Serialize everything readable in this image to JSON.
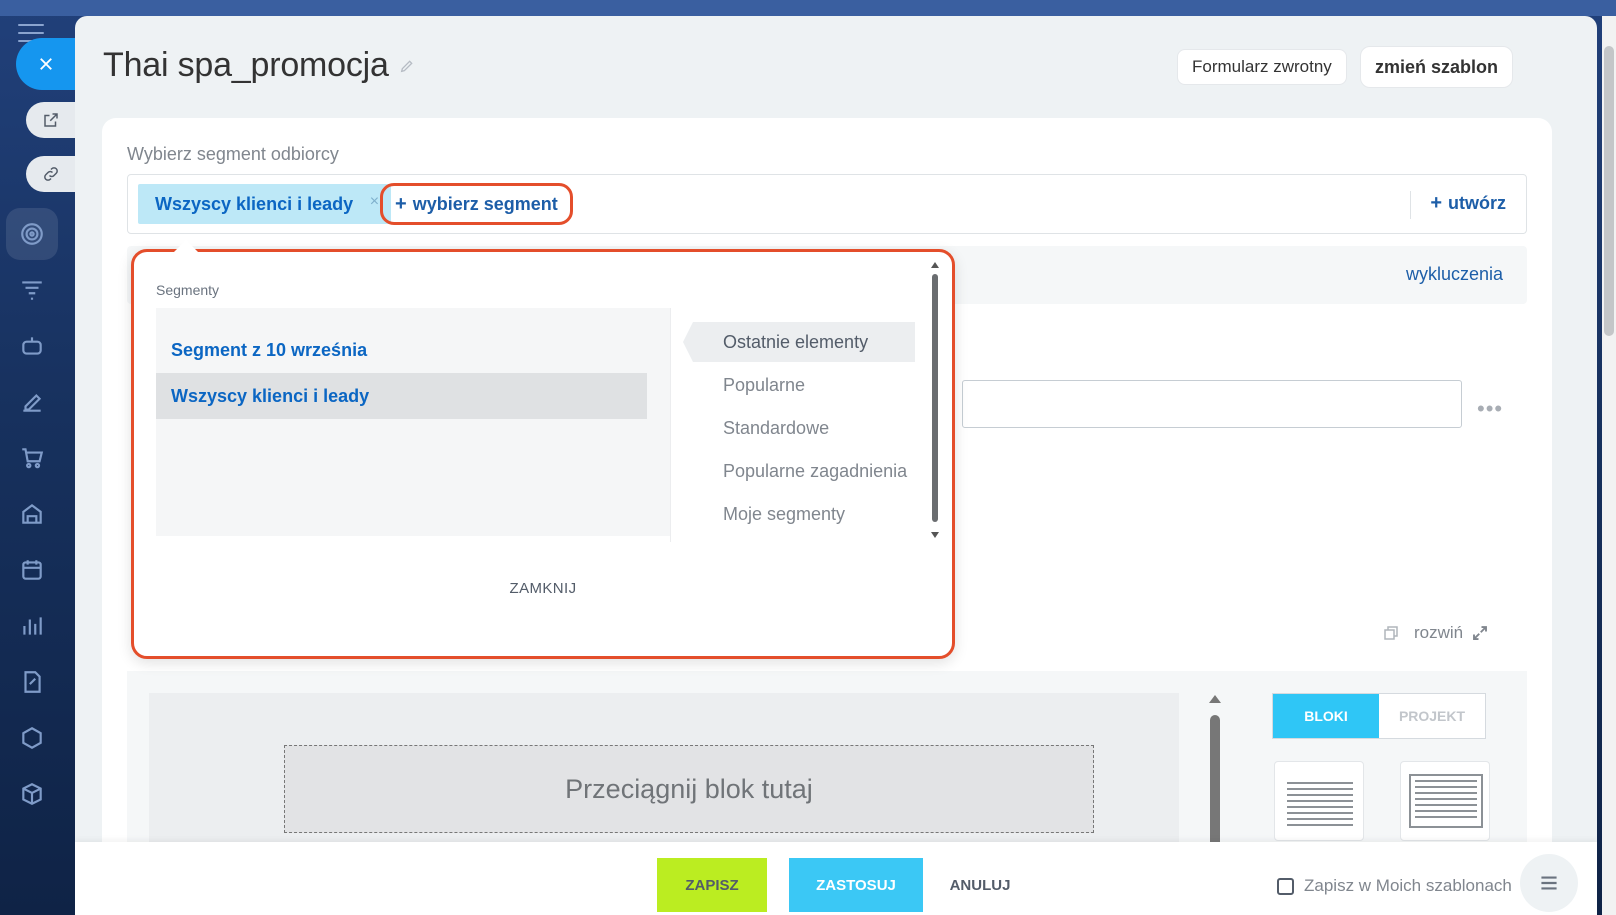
{
  "page": {
    "title": "Thai spa_promocja",
    "buttons": {
      "feedback_form": "Formularz zwrotny",
      "change_template": "zmień szablon"
    }
  },
  "segment_section": {
    "label": "Wybierz segment odbiorcy",
    "selected_chip": "Wszyscy klienci i leady",
    "chip_remove": "×",
    "choose_segment": "wybierz segment",
    "create": "utwórz",
    "plus": "+",
    "exclusions_link": "wykluczenia"
  },
  "popup": {
    "label": "Segmenty",
    "segments": [
      {
        "label": "Segment z 10 września",
        "selected": false
      },
      {
        "label": "Wszyscy klienci i leady",
        "selected": true
      }
    ],
    "categories": [
      {
        "label": "Ostatnie elementy",
        "active": true
      },
      {
        "label": "Popularne",
        "active": false
      },
      {
        "label": "Standardowe",
        "active": false
      },
      {
        "label": "Popularne zagadnienia",
        "active": false
      },
      {
        "label": "Moje segmenty",
        "active": false
      }
    ],
    "close_label": "ZAMKNIJ"
  },
  "editor": {
    "expand_label": "rozwiń",
    "drop_zone_text": "Przeciągnij blok tutaj",
    "tabs": [
      {
        "label": "BLOKI",
        "active": true
      },
      {
        "label": "PROJEKT",
        "active": false
      }
    ]
  },
  "footer": {
    "save": "ZAPISZ",
    "apply": "ZASTOSUJ",
    "cancel": "ANULUJ",
    "save_template": "Zapisz w Moich szablonach"
  },
  "colors": {
    "accent_blue": "#3bc8f5",
    "save_green": "#bbed21",
    "highlight_red": "#e44e2b",
    "link_blue": "#1d5ea8"
  }
}
